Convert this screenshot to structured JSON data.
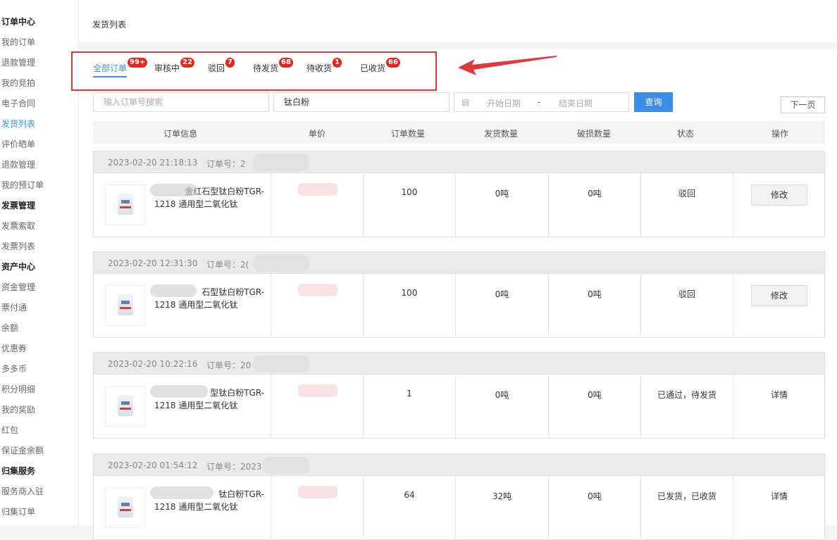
{
  "sidebar": {
    "items": [
      {
        "label": "订单中心",
        "kind": "group"
      },
      {
        "label": "我的订单",
        "kind": "link"
      },
      {
        "label": "退款管理",
        "kind": "link"
      },
      {
        "label": "我的竞拍",
        "kind": "link"
      },
      {
        "label": "电子合同",
        "kind": "link"
      },
      {
        "label": "发货列表",
        "kind": "active"
      },
      {
        "label": "评价晒单",
        "kind": "link"
      },
      {
        "label": "退款管理",
        "kind": "link"
      },
      {
        "label": "我的预订单",
        "kind": "link"
      },
      {
        "label": "发票管理",
        "kind": "group"
      },
      {
        "label": "发票索取",
        "kind": "link"
      },
      {
        "label": "发票列表",
        "kind": "link"
      },
      {
        "label": "资产中心",
        "kind": "group"
      },
      {
        "label": "资金管理",
        "kind": "link"
      },
      {
        "label": "票付通",
        "kind": "link"
      },
      {
        "label": "余额",
        "kind": "link"
      },
      {
        "label": "优惠券",
        "kind": "link"
      },
      {
        "label": "多多币",
        "kind": "link"
      },
      {
        "label": "积分明细",
        "kind": "link"
      },
      {
        "label": "我的奖励",
        "kind": "link"
      },
      {
        "label": "红包",
        "kind": "link"
      },
      {
        "label": "保证金余额",
        "kind": "link"
      },
      {
        "label": "归集服务",
        "kind": "group"
      },
      {
        "label": "服务商入驻",
        "kind": "link"
      },
      {
        "label": "归集订单",
        "kind": "link"
      }
    ]
  },
  "page": {
    "title": "发货列表"
  },
  "tabs": [
    {
      "label": "全部订单",
      "badge": "99+",
      "active": true
    },
    {
      "label": "审核中",
      "badge": "22"
    },
    {
      "label": "驳回",
      "badge": "7"
    },
    {
      "label": "待发货",
      "badge": "68"
    },
    {
      "label": "待收货",
      "badge": "1"
    },
    {
      "label": "已收货",
      "badge": "66"
    }
  ],
  "filters": {
    "order_search_placeholder": "输入订单号搜索",
    "product_value": "钛白粉",
    "start_date_placeholder": "开始日期",
    "date_sep": "-",
    "end_date_placeholder": "结束日期",
    "query_label": "查询",
    "next_page_label": "下一页"
  },
  "table": {
    "headers": [
      "订单信息",
      "单价",
      "订单数量",
      "发货数量",
      "破损数量",
      "状态",
      "操作"
    ]
  },
  "orders": [
    {
      "time": "2023-02-20 21:18:13",
      "order_no_label": "订单号：2",
      "name_line1": "金红石型钛白粉TGR-",
      "name_line2": "1218 通用型二氧化钛",
      "qty": "100",
      "shipped": "0吨",
      "damaged": "0吨",
      "status": "驳回",
      "action": "修改",
      "action_is_button": true
    },
    {
      "time": "2023-02-20 12:31:30",
      "order_no_label": "订单号：2(",
      "name_line1": "石型钛白粉TGR-",
      "name_line2": "1218 通用型二氧化钛",
      "qty": "100",
      "shipped": "0吨",
      "damaged": "0吨",
      "status": "驳回",
      "action": "修改",
      "action_is_button": true
    },
    {
      "time": "2023-02-20 10:22:16",
      "order_no_label": "订单号：20",
      "name_line1": "型钛白粉TGR-",
      "name_line2": "1218 通用型二氧化钛",
      "qty": "1",
      "shipped": "0吨",
      "damaged": "0吨",
      "status": "已通过，待发货",
      "action": "详情",
      "action_is_button": false
    },
    {
      "time": "2023-02-20 01:54:12",
      "order_no_label": "订单号：2023",
      "name_line1": "钛白粉TGR-",
      "name_line2": "1218 通用型二氧化钛",
      "qty": "64",
      "shipped": "32吨",
      "damaged": "0吨",
      "status": "已发货，已收货",
      "action": "详情",
      "action_is_button": false
    }
  ],
  "colors": {
    "accent": "#3a8ee6",
    "badge": "#e8271c",
    "highlight_box": "#e0393c"
  }
}
